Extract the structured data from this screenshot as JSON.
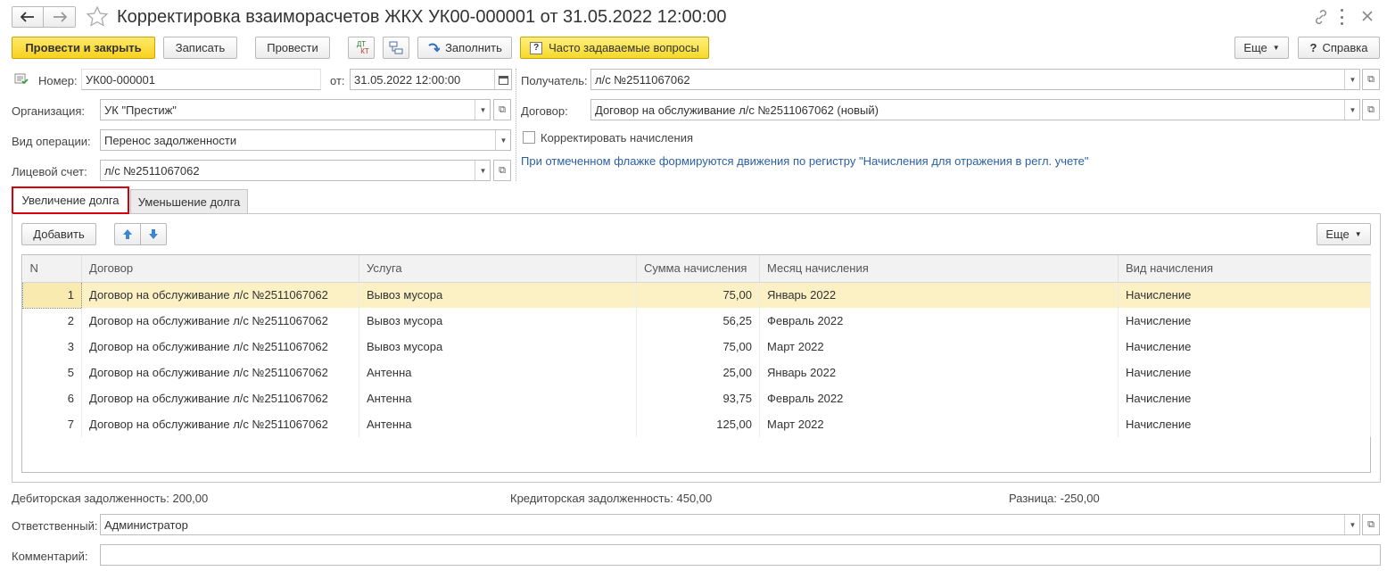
{
  "window": {
    "title": "Корректировка взаиморасчетов ЖКХ УК00-000001 от 31.05.2022 12:00:00"
  },
  "toolbar": {
    "post_close": "Провести и закрыть",
    "save": "Записать",
    "post": "Провести",
    "dtkt_top": "ДТ",
    "dtkt_bottom": "КТ",
    "fill": "Заполнить",
    "faq": "Часто задаваемые вопросы",
    "more": "Еще",
    "help": "Справка"
  },
  "header": {
    "number_label": "Номер:",
    "number_value": "УК00-000001",
    "date_label": "от:",
    "date_value": "31.05.2022 12:00:00",
    "org_label": "Организация:",
    "org_value": "УК \"Престиж\"",
    "op_label": "Вид операции:",
    "op_value": "Перенос задолженности",
    "account_label": "Лицевой счет:",
    "account_value": "л/с №2511067062",
    "recipient_label": "Получатель:",
    "recipient_value": "л/с №2511067062",
    "contract_label": "Договор:",
    "contract_value": "Договор на обслуживание л/с №2511067062 (новый)",
    "correct_label": "Корректировать начисления",
    "hint": "При отмеченном флажке формируются движения по регистру \"Начисления для отражения в регл. учете\""
  },
  "tabs": [
    {
      "label": "Увеличение долга"
    },
    {
      "label": "Уменьшение долга"
    }
  ],
  "table_toolbar": {
    "add": "Добавить",
    "more": "Еще"
  },
  "table": {
    "columns": [
      "N",
      "Договор",
      "Услуга",
      "Сумма начисления",
      "Месяц начисления",
      "Вид начисления"
    ],
    "rows": [
      {
        "n": "1",
        "contract": "Договор на обслуживание л/с №2511067062",
        "service": "Вывоз мусора",
        "amount": "75,00",
        "month": "Январь 2022",
        "kind": "Начисление"
      },
      {
        "n": "2",
        "contract": "Договор на обслуживание л/с №2511067062",
        "service": "Вывоз мусора",
        "amount": "56,25",
        "month": "Февраль 2022",
        "kind": "Начисление"
      },
      {
        "n": "3",
        "contract": "Договор на обслуживание л/с №2511067062",
        "service": "Вывоз мусора",
        "amount": "75,00",
        "month": "Март 2022",
        "kind": "Начисление"
      },
      {
        "n": "5",
        "contract": "Договор на обслуживание л/с №2511067062",
        "service": "Антенна",
        "amount": "25,00",
        "month": "Январь 2022",
        "kind": "Начисление"
      },
      {
        "n": "6",
        "contract": "Договор на обслуживание л/с №2511067062",
        "service": "Антенна",
        "amount": "93,75",
        "month": "Февраль 2022",
        "kind": "Начисление"
      },
      {
        "n": "7",
        "contract": "Договор на обслуживание л/с №2511067062",
        "service": "Антенна",
        "amount": "125,00",
        "month": "Март 2022",
        "kind": "Начисление"
      }
    ]
  },
  "footer": {
    "debit": "Дебиторская задолженность: 200,00",
    "credit": "Кредиторская задолженность: 450,00",
    "diff": "Разница: -250,00",
    "responsible_label": "Ответственный:",
    "responsible_value": "Администратор",
    "comment_label": "Комментарий:",
    "comment_value": ""
  },
  "colors": {
    "accent_yellow": "#f7d21e",
    "hint_blue": "#2b5fa6",
    "active_tab_border": "#d9000d",
    "selected_row": "#fbf1c5"
  }
}
